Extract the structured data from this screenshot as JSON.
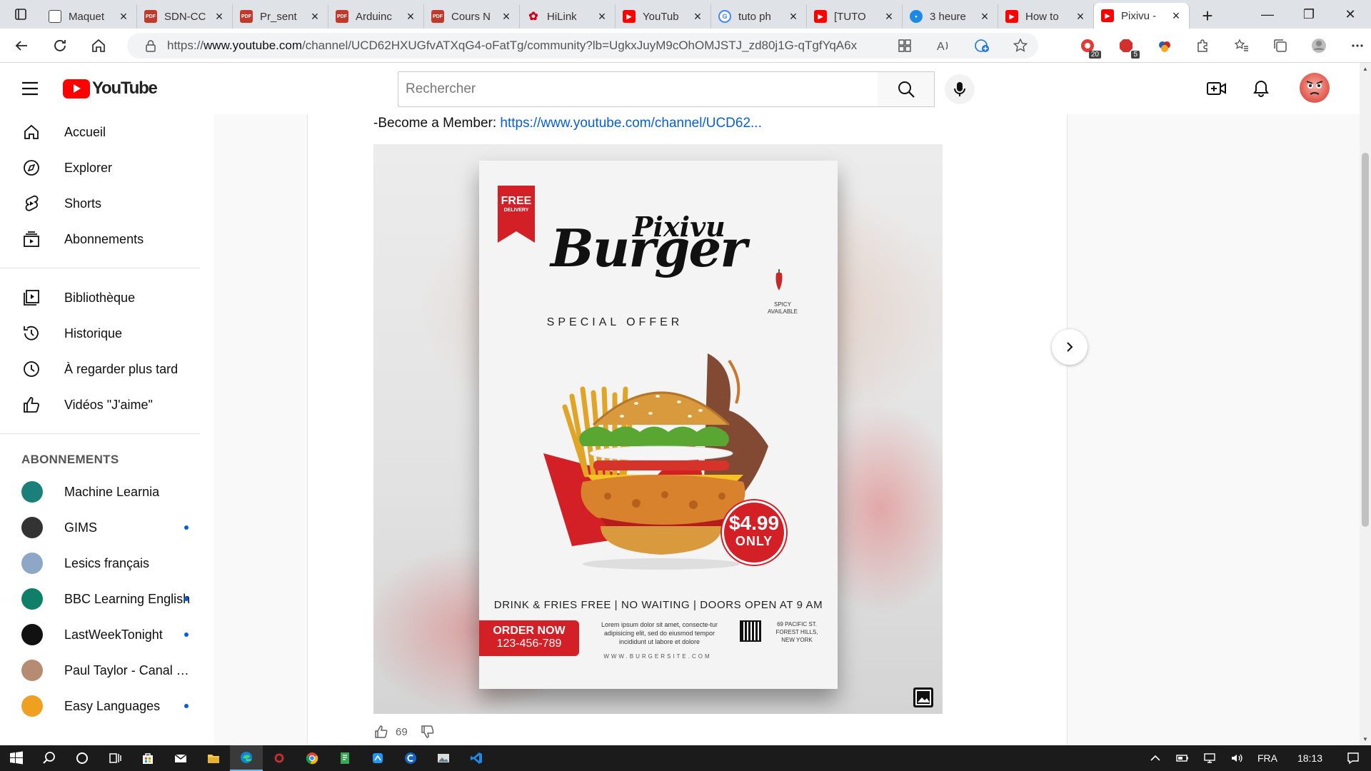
{
  "browser": {
    "tabs": [
      {
        "title": "Maquet",
        "favicon": "doc"
      },
      {
        "title": "SDN-CC",
        "favicon": "pdf"
      },
      {
        "title": "Pr_sent",
        "favicon": "pdf"
      },
      {
        "title": "Arduinc",
        "favicon": "pdf"
      },
      {
        "title": "Cours N",
        "favicon": "pdf"
      },
      {
        "title": "HiLink",
        "favicon": "hw"
      },
      {
        "title": "YouTub",
        "favicon": "yt"
      },
      {
        "title": "tuto ph",
        "favicon": "g"
      },
      {
        "title": "[TUTO",
        "favicon": "yt"
      },
      {
        "title": "3 heure",
        "favicon": "pin"
      },
      {
        "title": "How to",
        "favicon": "yt"
      },
      {
        "title": "Pixivu -",
        "favicon": "yt",
        "active": true
      }
    ],
    "url_prefix": "https://",
    "url_domain": "www.youtube.com",
    "url_path": "/channel/UCD62HXUGfvATXqG4-oFatTg/community?lb=UgkxJuyM9cOhOMJSTJ_zd80j1G-qTgfYqA6x",
    "ext_badges": {
      "ext1": "20",
      "ext2": "5"
    }
  },
  "youtube": {
    "logo_text": "YouTube",
    "search_placeholder": "Rechercher",
    "nav": [
      {
        "label": "Accueil",
        "icon": "home-icon"
      },
      {
        "label": "Explorer",
        "icon": "compass-icon"
      },
      {
        "label": "Shorts",
        "icon": "shorts-icon"
      },
      {
        "label": "Abonnements",
        "icon": "subscriptions-icon"
      }
    ],
    "library": [
      {
        "label": "Bibliothèque",
        "icon": "library-icon"
      },
      {
        "label": "Historique",
        "icon": "history-icon"
      },
      {
        "label": "À regarder plus tard",
        "icon": "clock-icon"
      },
      {
        "label": "Vidéos \"J'aime\"",
        "icon": "thumb-up-icon"
      }
    ],
    "subscriptions_title": "ABONNEMENTS",
    "subscriptions": [
      {
        "name": "Machine Learnia",
        "color": "#1b7f7a",
        "new": false
      },
      {
        "name": "GIMS",
        "color": "#333333",
        "new": true
      },
      {
        "name": "Lesics français",
        "color": "#8fa7c7",
        "new": false
      },
      {
        "name": "BBC Learning English",
        "color": "#0f7f6a",
        "new": true
      },
      {
        "name": "LastWeekTonight",
        "color": "#111111",
        "new": true
      },
      {
        "name": "Paul Taylor - Canal Plus",
        "color": "#b58b72",
        "new": false
      },
      {
        "name": "Easy Languages",
        "color": "#f0a020",
        "new": true
      }
    ]
  },
  "post": {
    "text_prefix": "-Become a Member: ",
    "link": "https://www.youtube.com/channel/UCD62...",
    "likes": "69",
    "poster": {
      "ribbon_top": "FREE",
      "ribbon_bottom": "DELIVERY",
      "brand_small": "Pixivu",
      "brand_big": "Burger",
      "offer": "SPECIAL OFFER",
      "spicy_1": "SPICY",
      "spicy_2": "AVAILABLE",
      "price": "$4.99",
      "price_only": "ONLY",
      "tagline": "DRINK & FRIES FREE | NO WAITING | DOORS OPEN AT 9 AM",
      "order_title": "ORDER NOW",
      "order_phone": "123-456-789",
      "lorem": "Lorem ipsum dolor sit amet, consecte-tur adipisicing elit, sed do eiusmod tempor incididunt ut labore et dolore",
      "address_1": "69 PACIFIC ST.",
      "address_2": "FOREST HILLS,",
      "address_3": "NEW YORK",
      "site": "WWW.BURGERSITE.COM"
    }
  },
  "taskbar": {
    "lang": "FRA",
    "time": "18:13"
  },
  "colors": {
    "youtube_red": "#ff0000",
    "link_blue": "#065fd4",
    "poster_red": "#d31f26"
  }
}
